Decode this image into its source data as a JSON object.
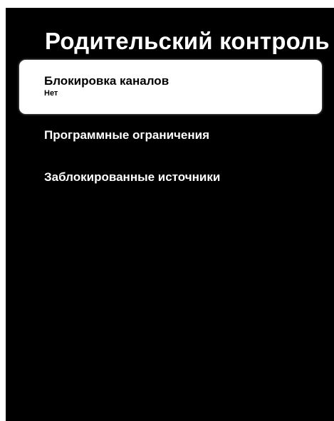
{
  "screen": {
    "title": "Родительский контроль"
  },
  "menu": {
    "items": [
      {
        "label": "Блокировка каналов",
        "value": "Нет",
        "selected": true
      },
      {
        "label": "Программные ограничения"
      },
      {
        "label": "Заблокированные источники"
      }
    ]
  },
  "colors": {
    "background": "#000000",
    "text": "#ffffff",
    "highlight_background": "#ffffff",
    "highlight_text": "#000000"
  }
}
